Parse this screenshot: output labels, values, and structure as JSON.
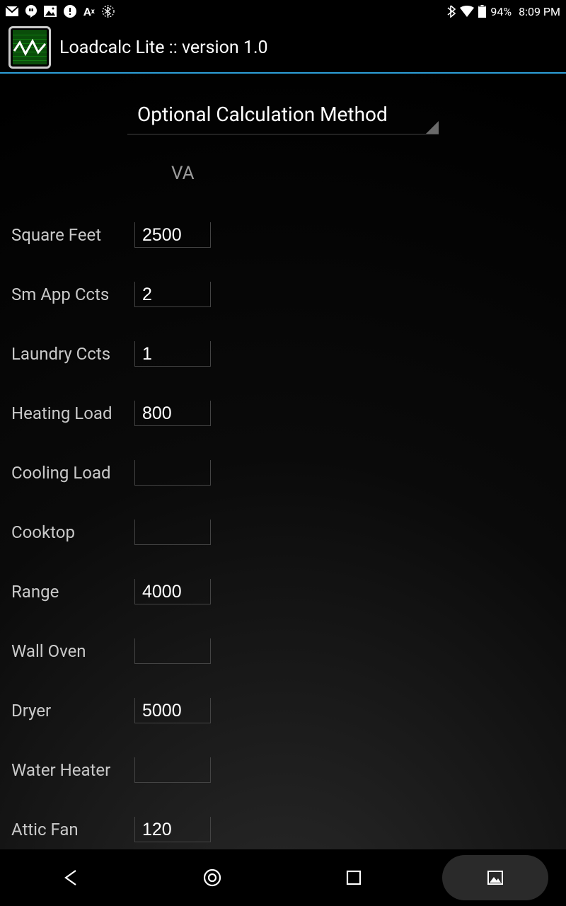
{
  "status": {
    "battery_pct": "94%",
    "time": "8:09 PM"
  },
  "app": {
    "title": "Loadcalc Lite :: version 1.0"
  },
  "spinner": {
    "selected": "Optional Calculation Method"
  },
  "header": {
    "va": "VA"
  },
  "fields": [
    {
      "label": "Square Feet",
      "value": "2500"
    },
    {
      "label": "Sm App Ccts",
      "value": "2"
    },
    {
      "label": "Laundry Ccts",
      "value": "1"
    },
    {
      "label": "Heating Load",
      "value": "800"
    },
    {
      "label": "Cooling Load",
      "value": ""
    },
    {
      "label": "Cooktop",
      "value": ""
    },
    {
      "label": "Range",
      "value": "4000"
    },
    {
      "label": "Wall Oven",
      "value": ""
    },
    {
      "label": "Dryer",
      "value": "5000"
    },
    {
      "label": "Water Heater",
      "value": ""
    },
    {
      "label": "Attic Fan",
      "value": "120"
    }
  ]
}
